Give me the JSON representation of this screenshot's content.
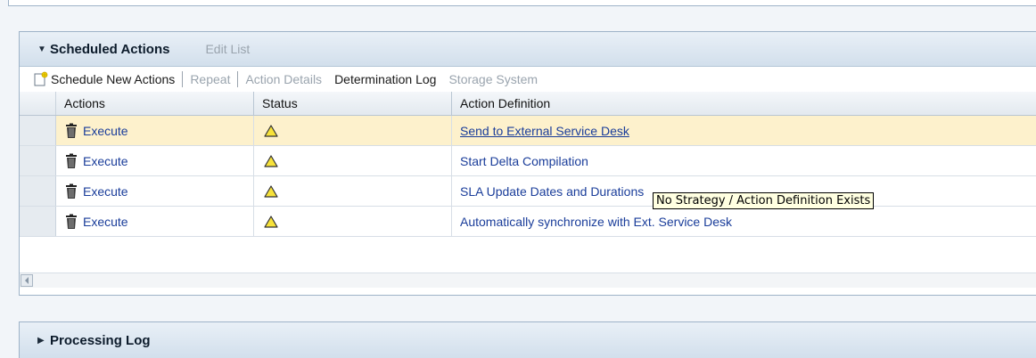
{
  "scheduled_actions": {
    "title": "Scheduled Actions",
    "edit_list": "Edit List",
    "toolbar": {
      "schedule_new": "Schedule New Actions",
      "repeat": "Repeat",
      "action_details": "Action Details",
      "determination_log": "Determination Log",
      "storage_system": "Storage System"
    },
    "columns": [
      "Actions",
      "Status",
      "Action Definition"
    ],
    "rows": [
      {
        "action": "Execute",
        "status_icon": "warning-triangle-icon",
        "definition": "Send to External Service Desk",
        "highlighted": true
      },
      {
        "action": "Execute",
        "status_icon": "warning-triangle-icon",
        "definition": "Start Delta Compilation",
        "highlighted": false
      },
      {
        "action": "Execute",
        "status_icon": "warning-triangle-icon",
        "definition": "SLA Update Dates and Durations",
        "highlighted": false
      },
      {
        "action": "Execute",
        "status_icon": "warning-triangle-icon",
        "definition": "Automatically synchronize with Ext. Service Desk",
        "highlighted": false
      }
    ]
  },
  "tooltip": "No Strategy / Action Definition Exists",
  "processing_log": {
    "title": "Processing Log"
  },
  "colors": {
    "link": "#1a3d9a",
    "highlight_row": "#fdf1cc",
    "header_bg": "#d2dfec",
    "warning": "#e8c800"
  }
}
